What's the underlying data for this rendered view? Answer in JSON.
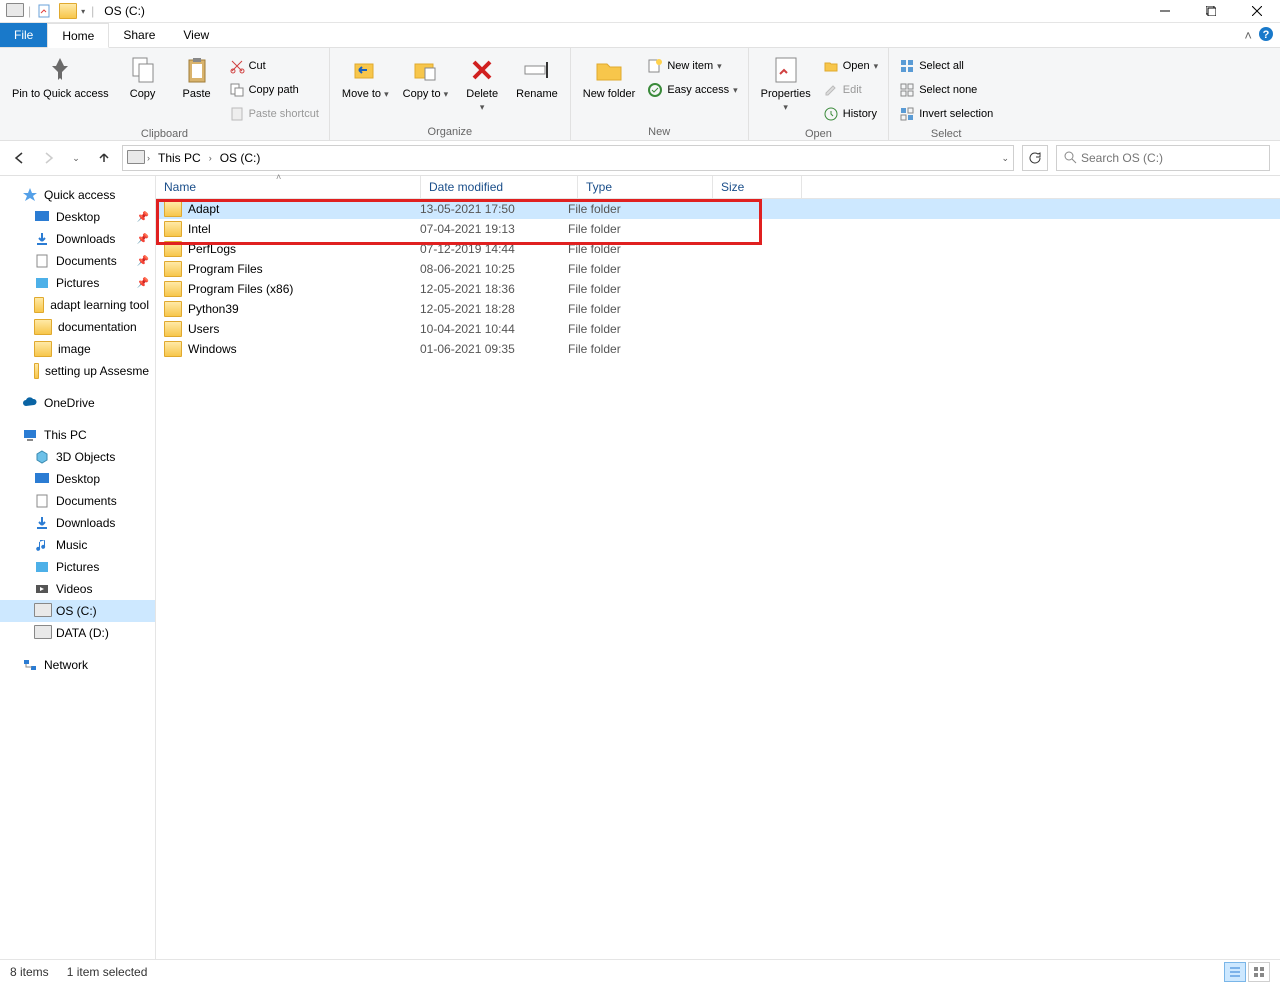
{
  "window": {
    "title": "OS (C:)"
  },
  "tabs": {
    "file": "File",
    "home": "Home",
    "share": "Share",
    "view": "View"
  },
  "ribbon": {
    "pin": "Pin to Quick access",
    "copy": "Copy",
    "paste": "Paste",
    "cut": "Cut",
    "copy_path": "Copy path",
    "paste_shortcut": "Paste shortcut",
    "group_clipboard": "Clipboard",
    "move_to": "Move to",
    "copy_to": "Copy to",
    "delete": "Delete",
    "rename": "Rename",
    "group_organize": "Organize",
    "new_folder": "New folder",
    "new_item": "New item",
    "easy_access": "Easy access",
    "group_new": "New",
    "properties": "Properties",
    "open": "Open",
    "edit": "Edit",
    "history": "History",
    "group_open": "Open",
    "select_all": "Select all",
    "select_none": "Select none",
    "invert": "Invert selection",
    "group_select": "Select"
  },
  "breadcrumb": {
    "this_pc": "This PC",
    "drive": "OS (C:)"
  },
  "search": {
    "placeholder": "Search OS (C:)"
  },
  "sidebar": {
    "quick_access": "Quick access",
    "desktop": "Desktop",
    "downloads": "Downloads",
    "documents": "Documents",
    "pictures": "Pictures",
    "adapt": "adapt learning tool",
    "documentation": "documentation",
    "image": "image",
    "setting_up": "setting up Assesme",
    "onedrive": "OneDrive",
    "this_pc": "This PC",
    "objects3d": "3D Objects",
    "desktop2": "Desktop",
    "documents2": "Documents",
    "downloads2": "Downloads",
    "music": "Music",
    "pictures2": "Pictures",
    "videos": "Videos",
    "osc": "OS (C:)",
    "datad": "DATA (D:)",
    "network": "Network"
  },
  "columns": {
    "name": "Name",
    "date": "Date modified",
    "type": "Type",
    "size": "Size"
  },
  "rows": [
    {
      "name": "Adapt",
      "date": "13-05-2021 17:50",
      "type": "File folder",
      "size": "",
      "selected": true
    },
    {
      "name": "Intel",
      "date": "07-04-2021 19:13",
      "type": "File folder",
      "size": ""
    },
    {
      "name": "PerfLogs",
      "date": "07-12-2019 14:44",
      "type": "File folder",
      "size": ""
    },
    {
      "name": "Program Files",
      "date": "08-06-2021 10:25",
      "type": "File folder",
      "size": ""
    },
    {
      "name": "Program Files (x86)",
      "date": "12-05-2021 18:36",
      "type": "File folder",
      "size": ""
    },
    {
      "name": "Python39",
      "date": "12-05-2021 18:28",
      "type": "File folder",
      "size": ""
    },
    {
      "name": "Users",
      "date": "10-04-2021 10:44",
      "type": "File folder",
      "size": ""
    },
    {
      "name": "Windows",
      "date": "01-06-2021 09:35",
      "type": "File folder",
      "size": ""
    }
  ],
  "status": {
    "items": "8 items",
    "selected": "1 item selected"
  }
}
